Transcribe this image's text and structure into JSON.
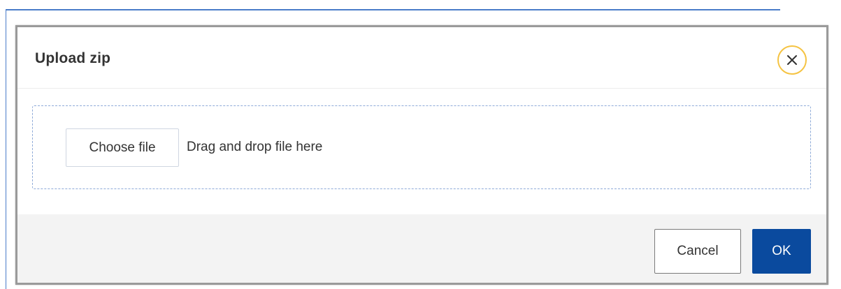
{
  "dialog": {
    "title": "Upload zip",
    "close_icon": "close-icon"
  },
  "upload": {
    "choose_label": "Choose file",
    "drop_hint": "Drag and drop file here"
  },
  "footer": {
    "cancel_label": "Cancel",
    "ok_label": "OK"
  },
  "colors": {
    "primary": "#0a4a9e",
    "close_ring": "#f5c342",
    "drop_border": "#8eaad8",
    "footer_bg": "#f3f3f3"
  }
}
